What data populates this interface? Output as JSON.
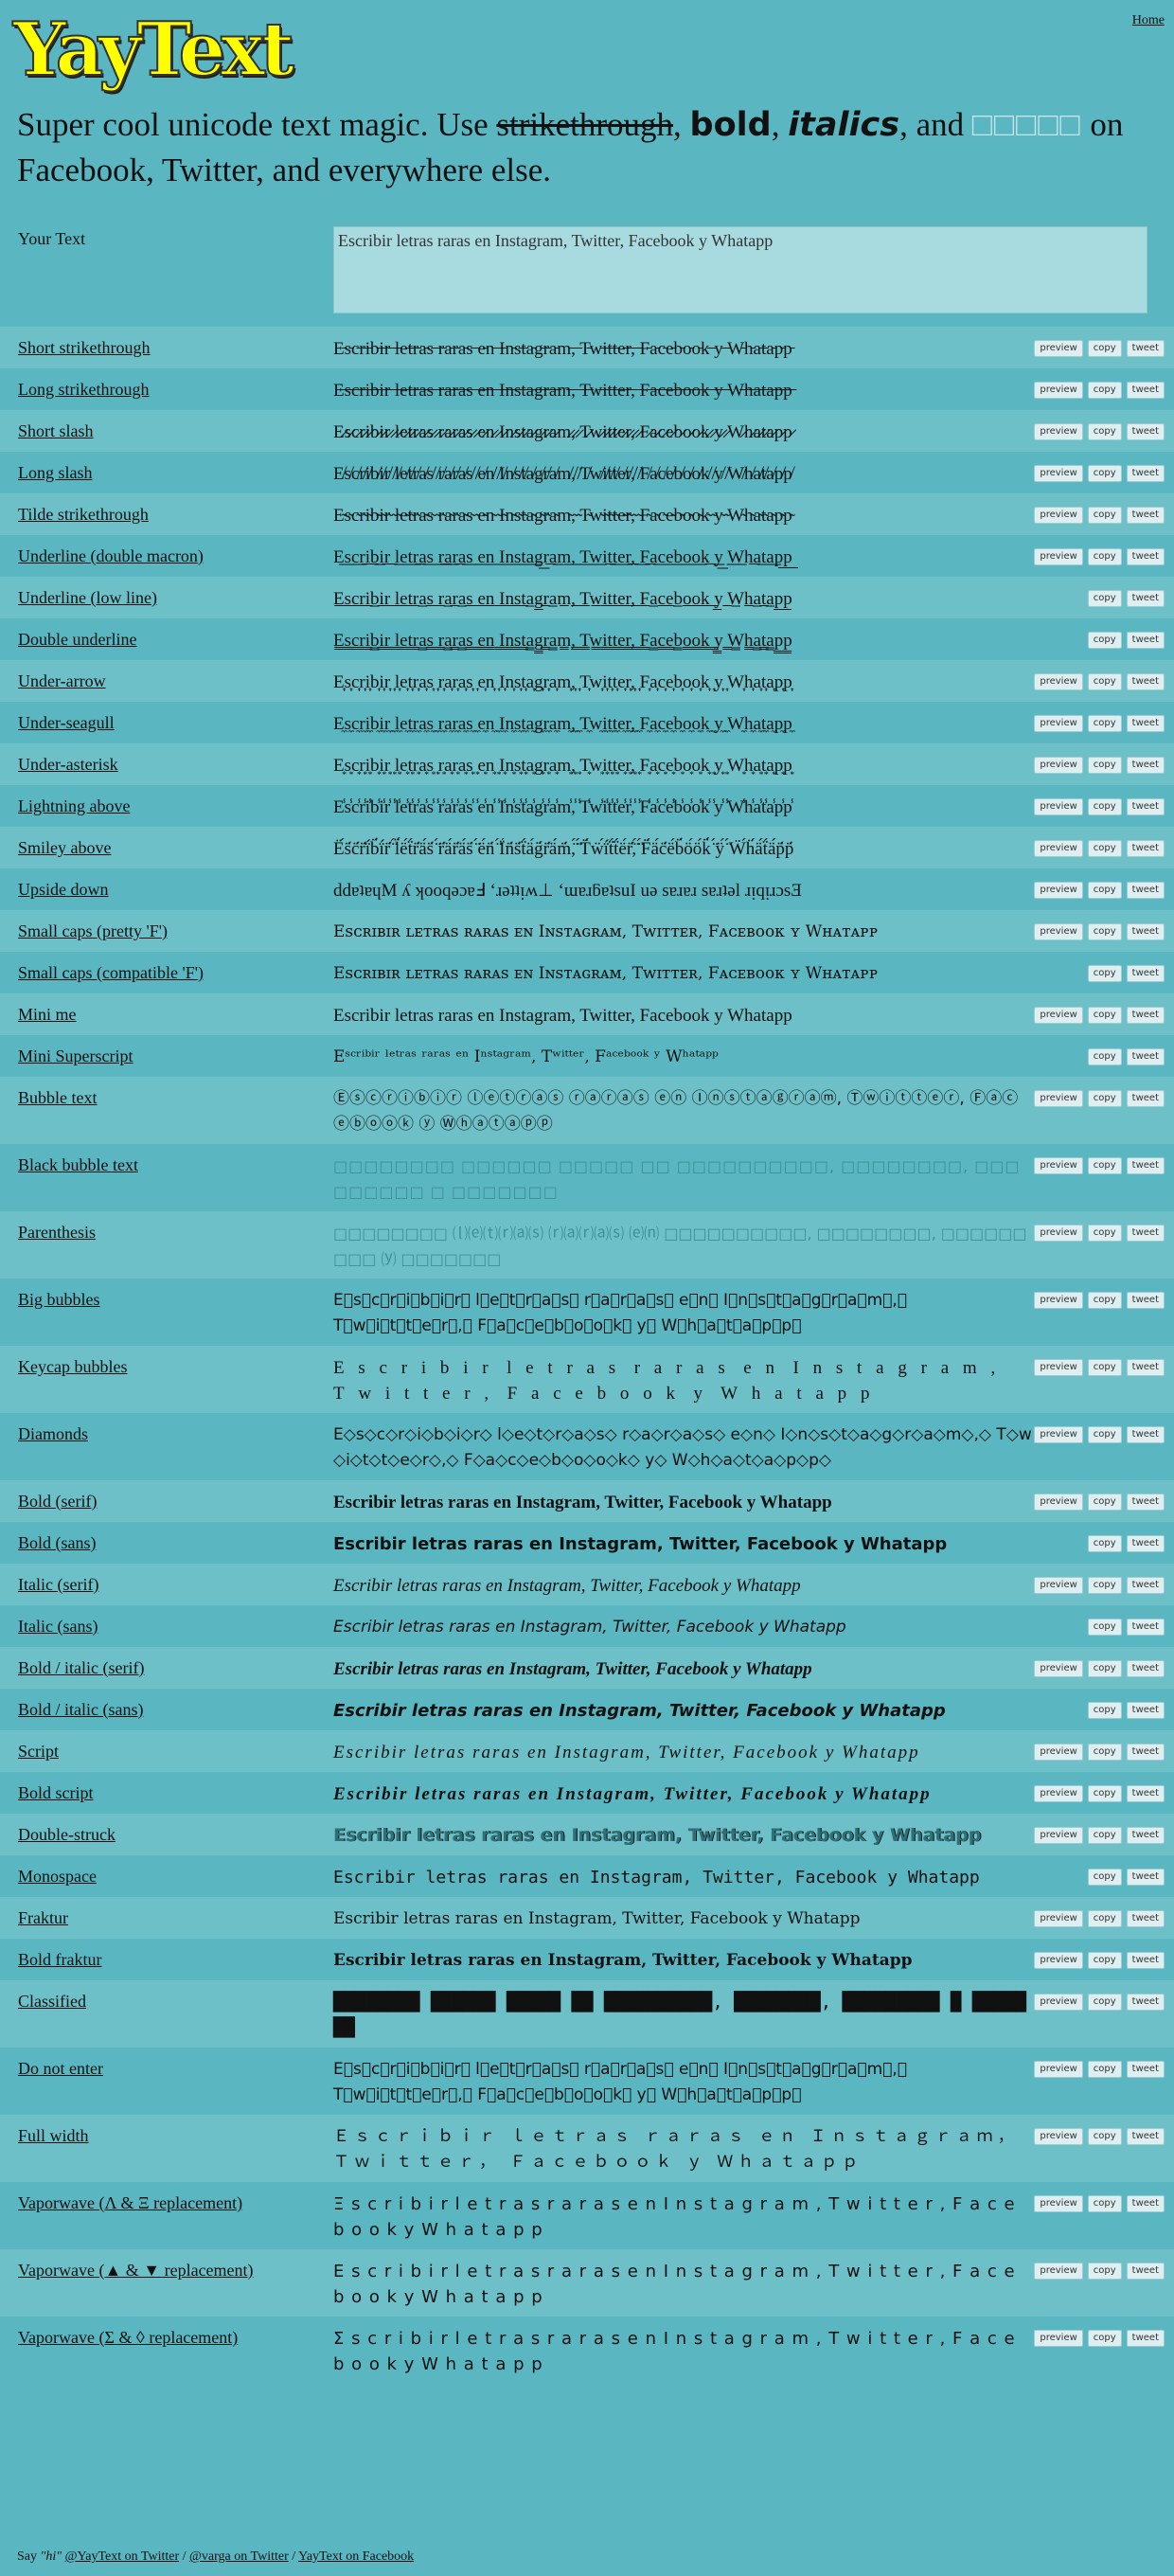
{
  "header": {
    "home_label": "Home",
    "logo": "YayText",
    "tagline_start": "Super cool unicode text magic. Use ",
    "tagline_strike": "strikethrough",
    "tagline_comma1": ", ",
    "tagline_bold": "bold",
    "tagline_comma2": ", ",
    "tagline_italics": "italics",
    "tagline_and": ", and ",
    "tagline_boxes": "□□□□□",
    "tagline_end": " on Facebook, Twitter, and everywhere else."
  },
  "input": {
    "label": "Your Text",
    "value": "Escribir letras raras en Instagram, Twitter, Facebook y Whatapp"
  },
  "buttons": {
    "preview": "preview",
    "copy": "copy",
    "tweet": "tweet"
  },
  "styles": [
    {
      "name": "Short strikethrough",
      "output": "E̵s̵c̵r̵i̵b̵i̵r̵ ̵l̵e̵t̵r̵a̵s̵ ̵r̵a̵r̵a̵s̵ ̵e̵n̵ ̵I̵n̵s̵t̵a̵g̵r̵a̵m̵,̵ ̵T̵w̵i̵t̵t̵e̵r̵,̵ ̵F̵a̵c̵e̵b̵o̵o̵k̵ ̵y̵ ̵W̵h̵a̵t̵a̵p̵p̵",
      "preview": true
    },
    {
      "name": "Long strikethrough",
      "output": "E̶s̶c̶r̶i̶b̶i̶r̶ ̶l̶e̶t̶r̶a̶s̶ ̶r̶a̶r̶a̶s̶ ̶e̶n̶ ̶I̶n̶s̶t̶a̶g̶r̶a̶m̶,̶ ̶T̶w̶i̶t̶t̶e̶r̶,̶ ̶F̶a̶c̶e̶b̶o̶o̶k̶ ̶y̶ ̶W̶h̶a̶t̶a̶p̶p̶",
      "preview": true
    },
    {
      "name": "Short slash",
      "output": "E̷s̷c̷r̷i̷b̷i̷r̷ ̷l̷e̷t̷r̷a̷s̷ ̷r̷a̷r̷a̷s̷ ̷e̷n̷ ̷I̷n̷s̷t̷a̷g̷r̷a̷m̷,̷ ̷T̷w̷i̷t̷t̷e̷r̷,̷ ̷F̷a̷c̷e̷b̷o̷o̷k̷ ̷y̷ ̷W̷h̷a̷t̷a̷p̷p̷",
      "preview": true
    },
    {
      "name": "Long slash",
      "output": "E̸s̸c̸r̸i̸b̸i̸r̸ ̸l̸e̸t̸r̸a̸s̸ ̸r̸a̸r̸a̸s̸ ̸e̸n̸ ̸I̸n̸s̸t̸a̸g̸r̸a̸m̸,̸ ̸T̸w̸i̸t̸t̸e̸r̸,̸ ̸F̸a̸c̸e̸b̸o̸o̸k̸ ̸y̸ ̸W̸h̸a̸t̸a̸p̸p̸",
      "preview": true
    },
    {
      "name": "Tilde strikethrough",
      "output": "E̴s̴c̴r̴i̴b̴i̴r̴ ̴l̴e̴t̴r̴a̴s̴ ̴r̴a̴r̴a̴s̴ ̴e̴n̴ ̴I̴n̴s̴t̴a̴g̴r̴a̴m̴,̴ ̴T̴w̴i̴t̴t̴e̴r̴,̴ ̴F̴a̴c̴e̴b̴o̴o̴k̴ ̴y̴ ̴W̴h̴a̴t̴a̴p̴p̴",
      "preview": true
    },
    {
      "name": "Underline (double macron)",
      "output": "E͟s͟c͟r͟i͟b͟i͟r͟ ͟l͟e͟t͟r͟a͟s͟ ͟r͟a͟r͟a͟s͟ ͟e͟n͟ ͟I͟n͟s͟t͟a͟g͟r͟a͟m͟,͟ ͟T͟w͟i͟t͟t͟e͟r͟,͟ ͟F͟a͟c͟e͟b͟o͟o͟k͟ ͟y͟ ͟W͟h͟a͟t͟a͟p͟p͟",
      "preview": true
    },
    {
      "name": "Underline (low line)",
      "output": "E̲s̲c̲r̲i̲b̲i̲r̲ ̲l̲e̲t̲r̲a̲s̲ ̲r̲a̲r̲a̲s̲ ̲e̲n̲ ̲I̲n̲s̲t̲a̲g̲r̲a̲m̲,̲ ̲T̲w̲i̲t̲t̲e̲r̲,̲ ̲F̲a̲c̲e̲b̲o̲o̲k̲ ̲y̲ ̲W̲h̲a̲t̲a̲p̲p̲",
      "preview": false
    },
    {
      "name": "Double underline",
      "output": "E̳s̳c̳r̳i̳b̳i̳r̳ ̳l̳e̳t̳r̳a̳s̳ ̳r̳a̳r̳a̳s̳ ̳e̳n̳ ̳I̳n̳s̳t̳a̳g̳r̳a̳m̳,̳ ̳T̳w̳i̳t̳t̳e̳r̳,̳ ̳F̳a̳c̳e̳b̳o̳o̳k̳ ̳y̳ ̳W̳h̳a̳t̳a̳p̳p̳",
      "preview": false
    },
    {
      "name": "Under-arrow",
      "output": "E͎s͎c͎r͎i͎b͎i͎r͎ ͎l͎e͎t͎r͎a͎s͎ ͎r͎a͎r͎a͎s͎ ͎e͎n͎ ͎I͎n͎s͎t͎a͎g͎r͎a͎m͎,͎ ͎T͎w͎i͎t͎t͎e͎r͎,͎ ͎F͎a͎c͎e͎b͎o͎o͎k͎ ͎y͎ ͎W͎h͎a͎t͎a͎p͎p͎",
      "preview": true
    },
    {
      "name": "Under-seagull",
      "output": "E̼s̼c̼r̼i̼b̼i̼r̼ ̼l̼e̼t̼r̼a̼s̼ ̼r̼a̼r̼a̼s̼ ̼e̼n̼ ̼I̼n̼s̼t̼a̼g̼r̼a̼m̼,̼ ̼T̼w̼i̼t̼t̼e̼r̼,̼ ̼F̼a̼c̼e̼b̼o̼o̼k̼ ̼y̼ ̼W̼h̼a̼t̼a̼p̼p̼",
      "preview": true
    },
    {
      "name": "Under-asterisk",
      "output": "E͙s͙c͙r͙i͙b͙i͙r͙ ͙l͙e͙t͙r͙a͙s͙ ͙r͙a͙r͙a͙s͙ ͙e͙n͙ ͙I͙n͙s͙t͙a͙g͙r͙a͙m͙,͙ ͙T͙w͙i͙t͙t͙e͙r͙,͙ ͙F͙a͙c͙e͙b͙o͙o͙k͙ ͙y͙ ͙W͙h͙a͙t͙a͙p͙p͙",
      "preview": true
    },
    {
      "name": "Lightning above",
      "output": "E̾s̾c̾r̾i̾b̾i̾r̾ ̾l̾e̾t̾r̾a̾s̾ ̾r̾a̾r̾a̾s̾ ̾e̾n̾ ̾I̾n̾s̾t̾a̾g̾r̾a̾m̾,̾ ̾T̾w̾i̾t̾t̾e̾r̾,̾ ̾F̾a̾c̾e̾b̾o̾o̾k̾ ̾y̾ ̾W̾h̾a̾t̾a̾p̾p̾",
      "preview": true
    },
    {
      "name": "Smiley above",
      "output": "Ë́s̈́c̈́r̈́ḯb̈́ḯr̈́ ̈́l̈́ë́ẗ́r̈́ä́s̈́ ̈́r̈́ä́r̈́ä́s̈́ ̈́ë́n̈́ ̈́Ḯn̈́s̈́ẗ́ä́g̈́r̈́ä́m̈́,̈́ ̈́T̈́ẅ́ḯẗ́ẗ́ë́r̈́,̈́ ̈́F̈́ä́c̈́ë́b̈́ö́ö́k̈́ ̈́ÿ́ ̈́Ẅ́ḧ́ä́ẗ́ä́p̈́p̈́",
      "preview": true
    },
    {
      "name": "Upside down",
      "output": "ddɐʇɐɥM ʎ ʞooqǝɔɐℲ ‘ɹǝʇʇᴉʍ⊥ ‘ɯɐɹƃɐʇsuI uǝ sɐɹɐɹ sɐɹʇǝl ɹᴉqᴉɹɔsƎ",
      "preview": true
    },
    {
      "name": "Small caps (pretty 'F')",
      "output": "Eꜱᴄʀɪʙɪʀ ʟᴇᴛʀᴀꜱ ʀᴀʀᴀꜱ ᴇɴ Iɴꜱᴛᴀɢʀᴀᴍ, Tᴡɪᴛᴛᴇʀ, Fᴀᴄᴇʙᴏᴏᴋ ʏ Wʜᴀᴛᴀᴘᴘ",
      "preview": true
    },
    {
      "name": "Small caps (compatible 'F')",
      "output": "Eꜱᴄʀɪʙɪʀ ʟᴇᴛʀᴀꜱ ʀᴀʀᴀꜱ ᴇɴ Iɴꜱᴛᴀɢʀᴀᴍ, Tᴡɪᴛᴛᴇʀ, Fᴀᴄᴇʙᴏᴏᴋ ʏ Wʜᴀᴛᴀᴘᴘ",
      "preview": false
    },
    {
      "name": "Mini me",
      "output": "Escribir letras raras en Instagram, Twitter, Facebook y Whatapp",
      "preview": true
    },
    {
      "name": "Mini Superscript",
      "output": "Eˢᶜʳⁱᵇⁱʳ ˡᵉᵗʳᵃˢ ʳᵃʳᵃˢ ᵉⁿ Iⁿˢᵗᵃᵍʳᵃᵐ, Tʷⁱᵗᵗᵉʳ, Fᵃᶜᵉᵇᵒᵒᵏ ʸ Wʰᵃᵗᵃᵖᵖ",
      "preview": false
    },
    {
      "name": "Bubble text",
      "output": "Ⓔⓢⓒⓡⓘⓑⓘⓡ ⓛⓔⓣⓡⓐⓢ ⓡⓐⓡⓐⓢ ⓔⓝ Ⓘⓝⓢⓣⓐⓖⓡⓐⓜ, Ⓣⓦⓘⓣⓣⓔⓡ, Ⓕⓐⓒⓔⓑⓞⓞⓚ ⓨ Ⓦⓗⓐⓣⓐⓟⓟ",
      "preview": true
    },
    {
      "name": "Black bubble text",
      "output": "□□□□□□□□ □□□□□□ □□□□□ □□ □□□□□□□□□□, □□□□□□□□, □□□□□□□□□ □ □□□□□□□",
      "preview": true
    },
    {
      "name": "Parenthesis",
      "output": "□□□□□□□□ ⒧⒠⒯⒭⒜⒮ ⒭⒜⒭⒜⒮ ⒠⒩ □□□□□□□□□□, □□□□□□□□, □□□□□□□□□ ⒴ □□□□□□□",
      "preview": true
    },
    {
      "name": "Big bubbles",
      "output": "E⃝s⃝c⃝r⃝i⃝b⃝i⃝r⃝ l⃝e⃝t⃝r⃝a⃝s⃝ r⃝a⃝r⃝a⃝s⃝ e⃝n⃝ I⃝n⃝s⃝t⃝a⃝g⃝r⃝a⃝m⃝,⃝ T⃝w⃝i⃝t⃝t⃝e⃝r⃝,⃝ F⃝a⃝c⃝e⃝b⃝o⃝o⃝k⃝ y⃝ W⃝h⃝a⃝t⃝a⃝p⃝p⃝",
      "preview": true
    },
    {
      "name": "Keycap bubbles",
      "output": "E⃣s⃣c⃣r⃣i⃣b⃣i⃣r⃣ l⃣e⃣t⃣r⃣a⃣s⃣ r⃣a⃣r⃣a⃣s⃣ e⃣n⃣ I⃣n⃣s⃣t⃣a⃣g⃣r⃣a⃣m⃣,⃣ T⃣w⃣i⃣t⃣t⃣e⃣r⃣,⃣ F⃣a⃣c⃣e⃣b⃣o⃣o⃣k⃣ y⃣ W⃣h⃣a⃣t⃣a⃣p⃣p⃣",
      "preview": true
    },
    {
      "name": "Diamonds",
      "output": "E◇s◇c◇r◇i◇b◇i◇r◇ l◇e◇t◇r◇a◇s◇ r◇a◇r◇a◇s◇ e◇n◇ I◇n◇s◇t◇a◇g◇r◇a◇m◇,◇ T◇w◇i◇t◇t◇e◇r◇,◇ F◇a◇c◇e◇b◇o◇o◇k◇ y◇ W◇h◇a◇t◇a◇p◇p◇",
      "preview": true
    },
    {
      "name": "Bold (serif)",
      "output": "Escribir letras raras en Instagram, Twitter, Facebook y Whatapp",
      "preview": true
    },
    {
      "name": "Bold (sans)",
      "output": "Escribir letras raras en Instagram, Twitter, Facebook y Whatapp",
      "preview": false
    },
    {
      "name": "Italic (serif)",
      "output": "Escribir letras raras en Instagram, Twitter, Facebook y Whatapp",
      "preview": true
    },
    {
      "name": "Italic (sans)",
      "output": "Escribir letras raras en Instagram, Twitter, Facebook y Whatapp",
      "preview": false
    },
    {
      "name": "Bold / italic (serif)",
      "output": "Escribir letras raras en Instagram, Twitter, Facebook y Whatapp",
      "preview": true
    },
    {
      "name": "Bold / italic (sans)",
      "output": "Escribir letras raras en Instagram, Twitter, Facebook y Whatapp",
      "preview": false
    },
    {
      "name": "Script",
      "output": "Escribir letras raras en Instagram, Twitter, Facebook y Whatapp",
      "preview": true
    },
    {
      "name": "Bold script",
      "output": "Escribir letras raras en Instagram, Twitter, Facebook y Whatapp",
      "preview": true
    },
    {
      "name": "Double-struck",
      "output": "Escribir letras raras en Instagram, Twitter, Facebook y Whatapp",
      "preview": true
    },
    {
      "name": "Monospace",
      "output": "Escribir letras raras en Instagram, Twitter, Facebook y Whatapp",
      "preview": false
    },
    {
      "name": "Fraktur",
      "output": "Escribir letras raras en Instagram, Twitter, Facebook y Whatapp",
      "preview": true
    },
    {
      "name": "Bold fraktur",
      "output": "Escribir letras raras en Instagram, Twitter, Facebook y Whatapp",
      "preview": true
    },
    {
      "name": "Classified",
      "output": "████████ ██████ █████ ██ ██████████, ████████, █████████ █ ███████",
      "preview": true
    },
    {
      "name": "Do not enter",
      "output": "E⃠s⃠c⃠r⃠i⃠b⃠i⃠r⃠ l⃠e⃠t⃠r⃠a⃠s⃠ r⃠a⃠r⃠a⃠s⃠ e⃠n⃠ I⃠n⃠s⃠t⃠a⃠g⃠r⃠a⃠m⃠,⃠ T⃠w⃠i⃠t⃠t⃠e⃠r⃠,⃠ F⃠a⃠c⃠e⃠b⃠o⃠o⃠k⃠ y⃠ W⃠h⃠a⃠t⃠a⃠p⃠p⃠",
      "preview": true
    },
    {
      "name": "Full width",
      "output": "Ｅｓｃｒｉｂｉｒ ｌｅｔｒａｓ ｒａｒａｓ ｅｎ Ｉｎｓｔａｇｒａｍ， Ｔｗｉｔｔｅｒ， Ｆａｃｅｂｏｏｋ ｙ Ｗｈａｔａｐｐ",
      "preview": true
    },
    {
      "name": "Vaporwave (Λ & Ξ replacement)",
      "output": "Ξ s c r i b i r   l e t r a s   r a r a s   e n   I n s t a g r a m ,   T w i t t e r ,   F a c e b o o k   y   W h a t a p p",
      "preview": true
    },
    {
      "name": "Vaporwave (▲ & ▼ replacement)",
      "output": "E s c r i b i r   l e t r a s   r a r a s   e n   I n s t a g r a m ,   T w i t t e r ,   F a c e b o o k   y   W h a t a p p",
      "preview": true
    },
    {
      "name": "Vaporwave (Σ & ◊ replacement)",
      "output": "Σ s c r i b i r   l e t r a s   r a r a s   e n   I n s t a g r a m ,   T w i t t e r ,   F a c e b o o k   y   W h a t a p p",
      "preview": true
    }
  ],
  "footer": {
    "say": "Say ",
    "hi": "\"hi\"",
    "link1": "@YayText on Twitter",
    "sep1": " / ",
    "link2": "@varga on Twitter",
    "sep2": " / ",
    "link3": "YayText on Facebook"
  }
}
